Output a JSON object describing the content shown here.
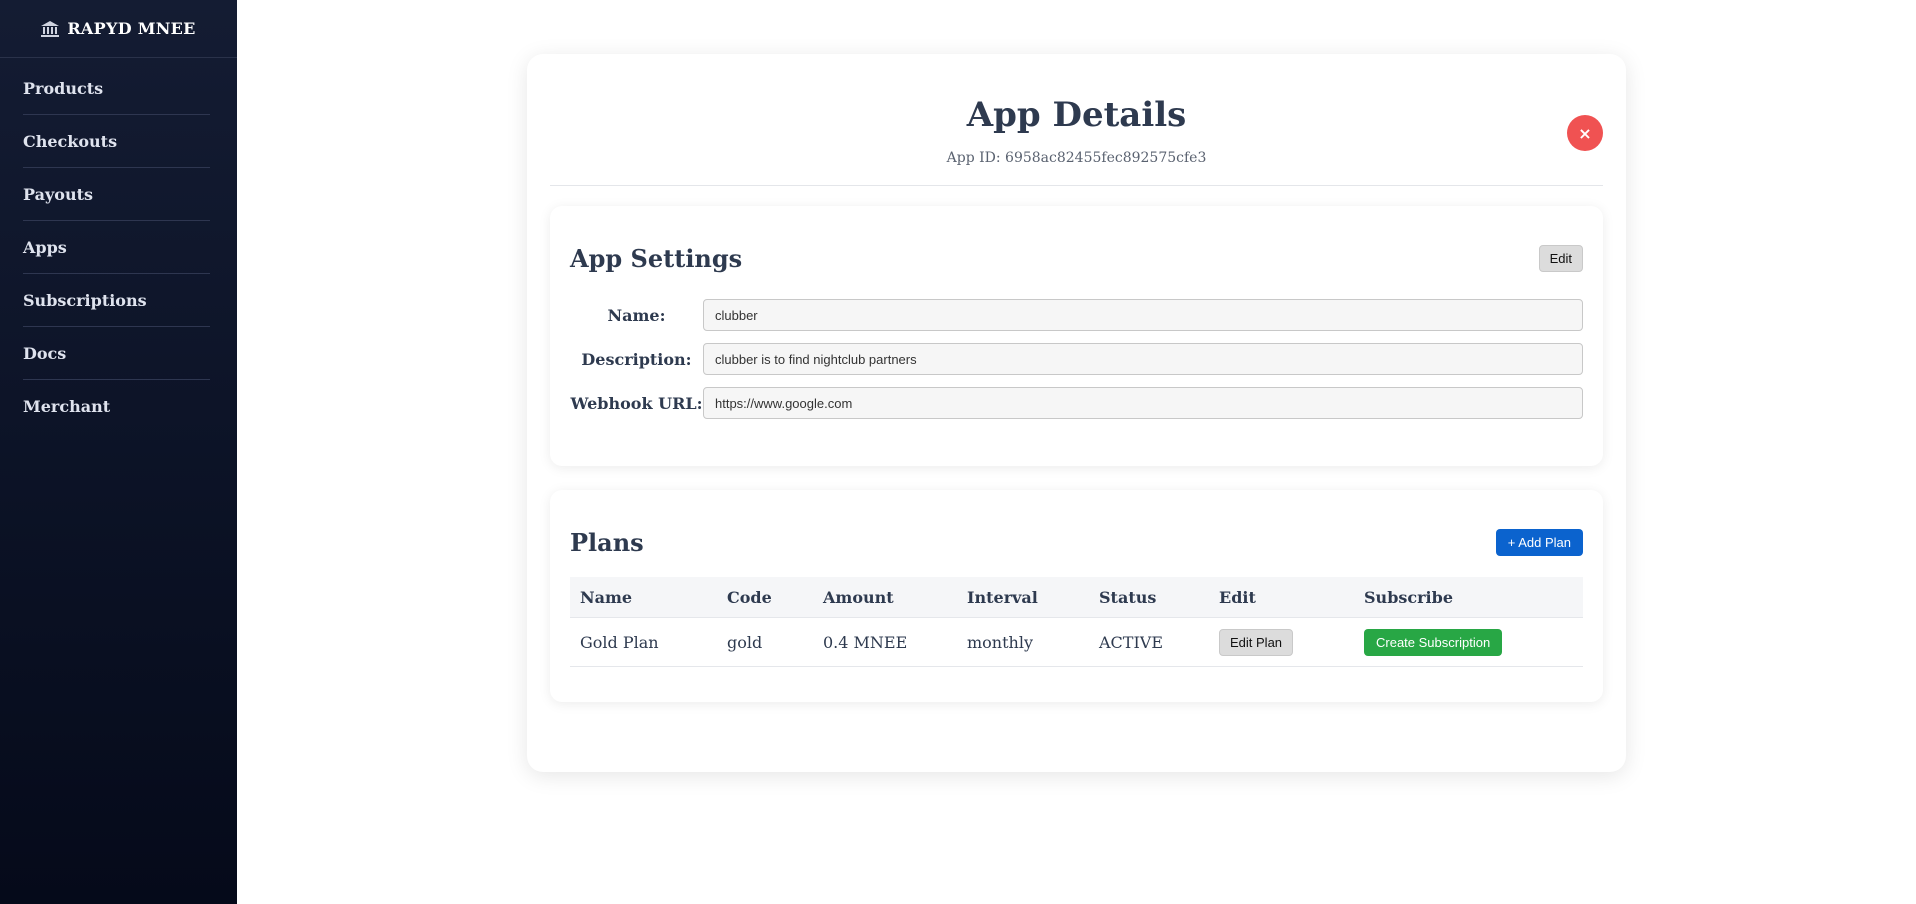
{
  "sidebar": {
    "brand": "RAPYD MNEE",
    "items": [
      {
        "label": "Products"
      },
      {
        "label": "Checkouts"
      },
      {
        "label": "Payouts"
      },
      {
        "label": "Apps"
      },
      {
        "label": "Subscriptions"
      },
      {
        "label": "Docs"
      },
      {
        "label": "Merchant"
      }
    ]
  },
  "modal": {
    "title": "App Details",
    "app_id": "App ID: 6958ac82455fec892575cfe3",
    "close_label": "×"
  },
  "settings": {
    "title": "App Settings",
    "edit_label": "Edit",
    "fields": [
      {
        "label": "Name:",
        "value": "clubber"
      },
      {
        "label": "Description:",
        "value": "clubber is to find nightclub partners"
      },
      {
        "label": "Webhook URL:",
        "value": "https://www.google.com"
      }
    ]
  },
  "plans": {
    "title": "Plans",
    "add_label": "+ Add Plan",
    "columns": [
      "Name",
      "Code",
      "Amount",
      "Interval",
      "Status",
      "Edit",
      "Subscribe"
    ],
    "rows": [
      {
        "name": "Gold Plan",
        "code": "gold",
        "amount": "0.4 MNEE",
        "interval": "monthly",
        "status": "ACTIVE",
        "edit_label": "Edit Plan",
        "subscribe_label": "Create Subscription"
      }
    ]
  },
  "colors": {
    "accent_blue": "#0b63ce",
    "success_green": "#28a745",
    "danger_red": "#f05252",
    "sidebar_bg": "#0d1428"
  },
  "icons": {
    "brand": "bank-icon",
    "close": "close-icon"
  }
}
